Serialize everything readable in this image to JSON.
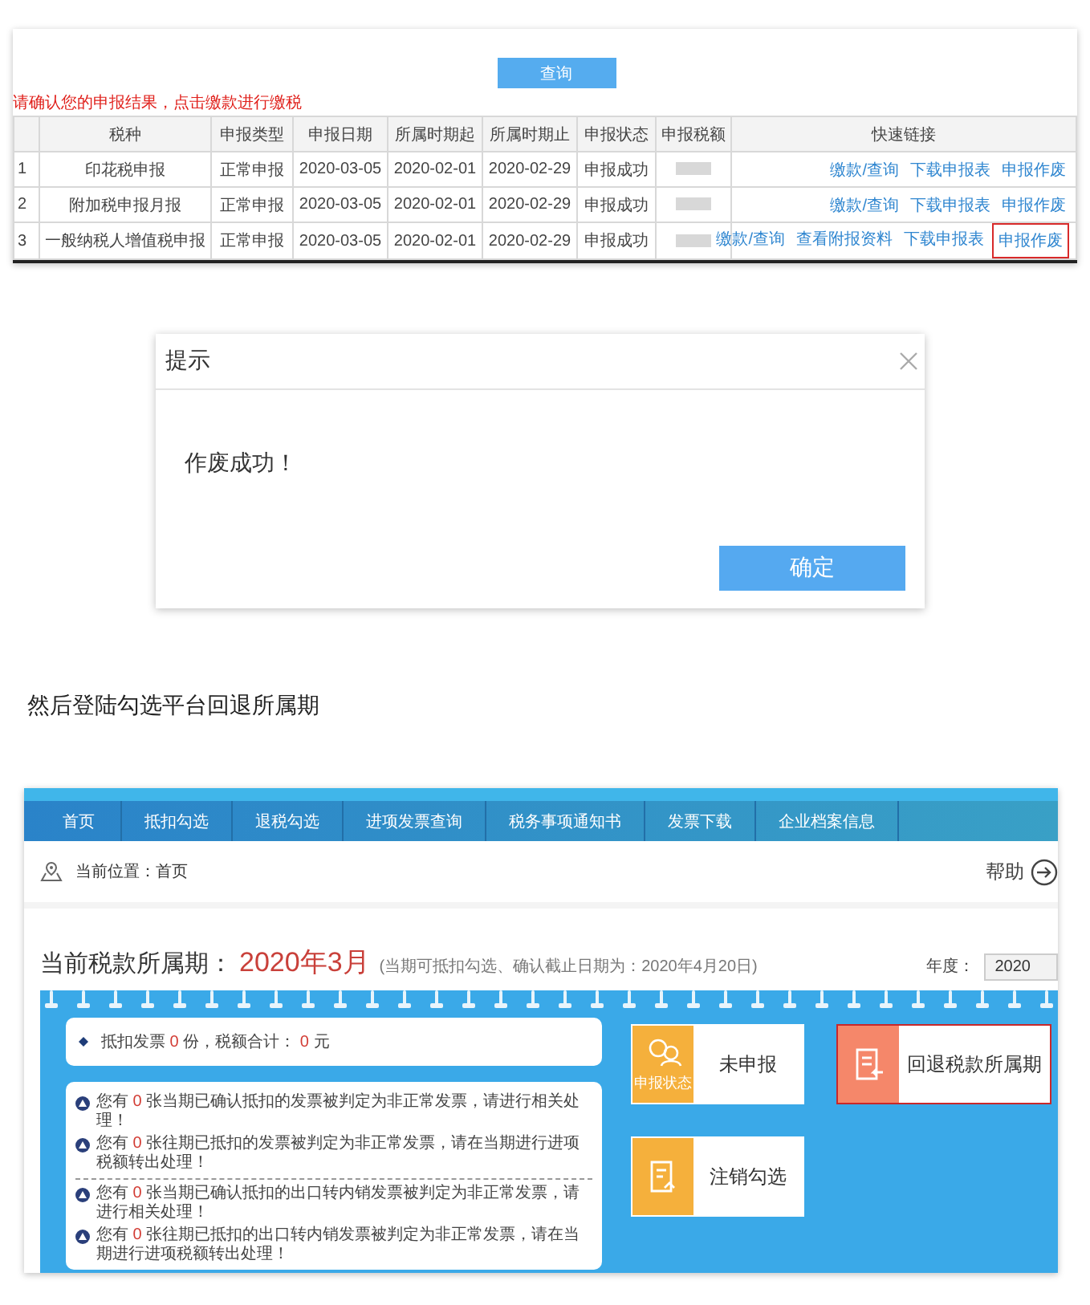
{
  "declaration_screen": {
    "query_button": "查询",
    "hint": "请确认您的申报结果，点击缴款进行缴税",
    "table": {
      "columns": [
        "税种",
        "申报类型",
        "申报日期",
        "所属时期起",
        "所属时期止",
        "申报状态",
        "申报税额",
        "快速链接"
      ],
      "rows": [
        {
          "index": "1",
          "tax_type": "印花税申报",
          "declare_type": "正常申报",
          "declare_date": "2020-03-05",
          "period_start": "2020-02-01",
          "period_end": "2020-02-29",
          "status": "申报成功",
          "links": [
            {
              "label": "缴款/查询",
              "highlighted": false
            },
            {
              "label": "下载申报表",
              "highlighted": false
            },
            {
              "label": "申报作废",
              "highlighted": false
            }
          ]
        },
        {
          "index": "2",
          "tax_type": "附加税申报月报",
          "declare_type": "正常申报",
          "declare_date": "2020-03-05",
          "period_start": "2020-02-01",
          "period_end": "2020-02-29",
          "status": "申报成功",
          "links": [
            {
              "label": "缴款/查询",
              "highlighted": false
            },
            {
              "label": "下载申报表",
              "highlighted": false
            },
            {
              "label": "申报作废",
              "highlighted": false
            }
          ]
        },
        {
          "index": "3",
          "tax_type": "一般纳税人增值税申报",
          "declare_type": "正常申报",
          "declare_date": "2020-03-05",
          "period_start": "2020-02-01",
          "period_end": "2020-02-29",
          "status": "申报成功",
          "links": [
            {
              "label": "缴款/查询",
              "highlighted": false
            },
            {
              "label": "查看附报资料",
              "highlighted": false
            },
            {
              "label": "下载申报表",
              "highlighted": false
            },
            {
              "label": "申报作废",
              "highlighted": true
            }
          ]
        }
      ]
    }
  },
  "dialog": {
    "title": "提示",
    "message": "作废成功！",
    "confirm_button": "确定"
  },
  "paragraph": "然后登陆勾选平台回退所属期",
  "platform": {
    "nav": [
      "首页",
      "抵扣勾选",
      "退税勾选",
      "进项发票查询",
      "税务事项通知书",
      "发票下载",
      "企业档案信息"
    ],
    "breadcrumb": "当前位置：首页",
    "help": "帮助",
    "period_label": "当前税款所属期：",
    "period": "2020年3月",
    "period_note": "(当期可抵扣勾选、确认截止日期为：2020年4月20日)",
    "year_label": "年度：",
    "year": "2020",
    "summary": {
      "before": "抵扣发票",
      "count": "0",
      "middle": "份，税额合计：",
      "total": "0",
      "after": "元"
    },
    "notice_groups": [
      [
        {
          "before": "您有",
          "count": "0",
          "after": "张当期已确认抵扣的发票被判定为非正常发票，请进行相关处理！"
        },
        {
          "before": "您有",
          "count": "0",
          "after": "张往期已抵扣的发票被判定为非正常发票，请在当期进行进项税额转出处理！"
        }
      ],
      [
        {
          "before": "您有",
          "count": "0",
          "after": "张当期已确认抵扣的出口转内销发票被判定为非正常发票，请进行相关处理！"
        },
        {
          "before": "您有",
          "count": "0",
          "after": "张往期已抵扣的出口转内销发票被判定为非正常发票，请在当期进行进项税额转出处理！"
        }
      ]
    ],
    "tiles": [
      {
        "kind": "status",
        "label": "未申报",
        "caption": "申报状态",
        "color": "#f5b03c",
        "highlighted": false
      },
      {
        "kind": "rollback",
        "label": "回退税款所属期",
        "color": "#f5876a",
        "highlighted": true
      },
      {
        "kind": "cancel",
        "label": "注销勾选",
        "color": "#f5b03c",
        "highlighted": false
      }
    ]
  }
}
